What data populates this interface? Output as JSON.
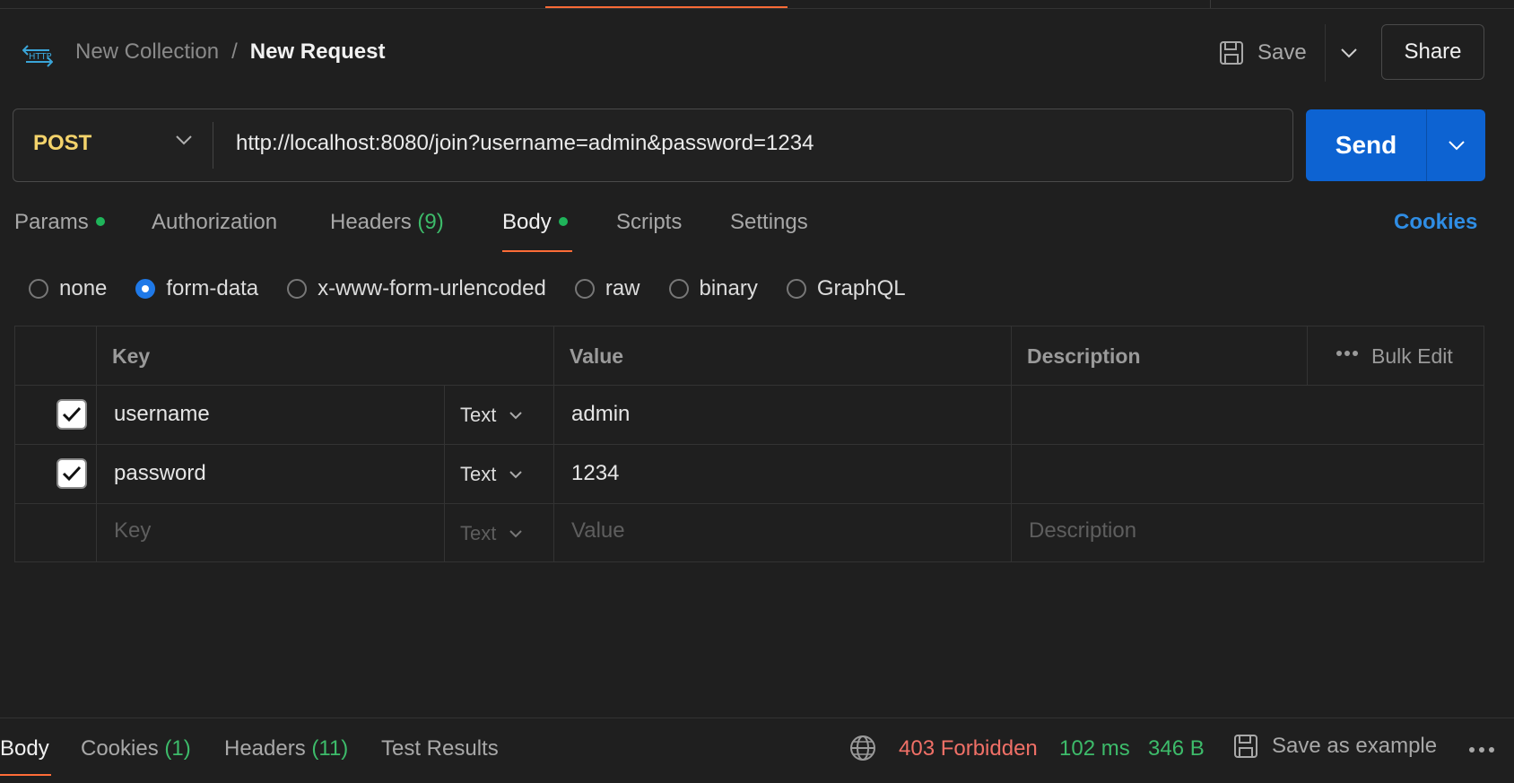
{
  "breadcrumb": {
    "collection": "New Collection",
    "separator": "/",
    "request": "New Request"
  },
  "header": {
    "save_label": "Save",
    "share_label": "Share"
  },
  "request": {
    "method": "POST",
    "url": "http://localhost:8080/join?username=admin&password=1234",
    "send_label": "Send"
  },
  "tabs": {
    "params": "Params",
    "authorization": "Authorization",
    "headers": "Headers",
    "headers_count": "(9)",
    "body": "Body",
    "scripts": "Scripts",
    "settings": "Settings",
    "cookies": "Cookies"
  },
  "body_types": {
    "none": "none",
    "form_data": "form-data",
    "urlencoded": "x-www-form-urlencoded",
    "raw": "raw",
    "binary": "binary",
    "graphql": "GraphQL",
    "selected": "form-data"
  },
  "table": {
    "headers": {
      "key": "Key",
      "value": "Value",
      "description": "Description",
      "bulk_edit": "Bulk Edit"
    },
    "rows": [
      {
        "key": "username",
        "type": "Text",
        "value": "admin",
        "description": ""
      },
      {
        "key": "password",
        "type": "Text",
        "value": "1234",
        "description": ""
      }
    ],
    "new_row": {
      "key": "Key",
      "type": "Text",
      "value": "Value",
      "description": "Description"
    }
  },
  "response": {
    "tabs": {
      "body": "Body",
      "cookies": "Cookies",
      "cookies_count": "(1)",
      "headers": "Headers",
      "headers_count": "(11)",
      "test_results": "Test Results"
    },
    "status": "403 Forbidden",
    "time": "102 ms",
    "size": "346 B",
    "save_example": "Save as example"
  },
  "colors": {
    "accent": "#ff6c37",
    "send": "#0d63d2",
    "method": "#f4d36b",
    "status_error": "#f07067",
    "status_ok": "#3dbb6a",
    "link": "#2f8de4"
  }
}
